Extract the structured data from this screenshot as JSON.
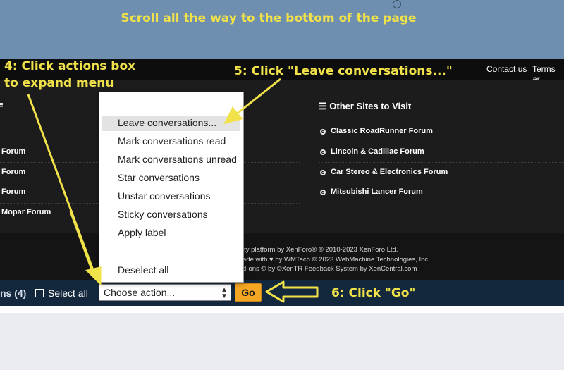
{
  "instructions": {
    "top": "Scroll all the way to the bottom of the page",
    "step4_line1": "4: Click actions box",
    "step4_line2": "to expand menu",
    "step5": "5: Click \"Leave conversations...\"",
    "step6": "6: Click \"Go\""
  },
  "header": {
    "contact": "Contact us",
    "terms": "Terms ar"
  },
  "footer": {
    "left_heading_icon": "≡",
    "right_heading": "☰ Other Sites to Visit",
    "left_links": [
      "Forum",
      "Forum",
      "Forum",
      "Mopar Forum"
    ],
    "right_links": [
      "Classic RoadRunner Forum",
      "Lincoln & Cadillac Forum",
      "Car Stereo & Electronics Forum",
      "Mitsubishi Lancer Forum"
    ],
    "copyright": [
      "ity platform by XenForo® © 2010-2023 XenForo Ltd.",
      "ade with ♥ by WMTech © 2023 WebMachine Technologies, Inc.",
      "d-ons © by ©XenTR Feedback System by XenCentral.com"
    ]
  },
  "action_menu": {
    "items": [
      "Leave conversations...",
      "Mark conversations read",
      "Mark conversations unread",
      "Star conversations",
      "Unstar conversations",
      "Sticky conversations",
      "Apply label",
      "Deselect all"
    ],
    "highlighted_index": 0
  },
  "action_bar": {
    "count_label": "ns (4)",
    "select_all": "Select all",
    "select_value": "Choose action...",
    "go_label": "Go"
  },
  "colors": {
    "annotation": "#f1e24a",
    "go_button": "#f5a623",
    "banner": "#6f8fb0"
  }
}
